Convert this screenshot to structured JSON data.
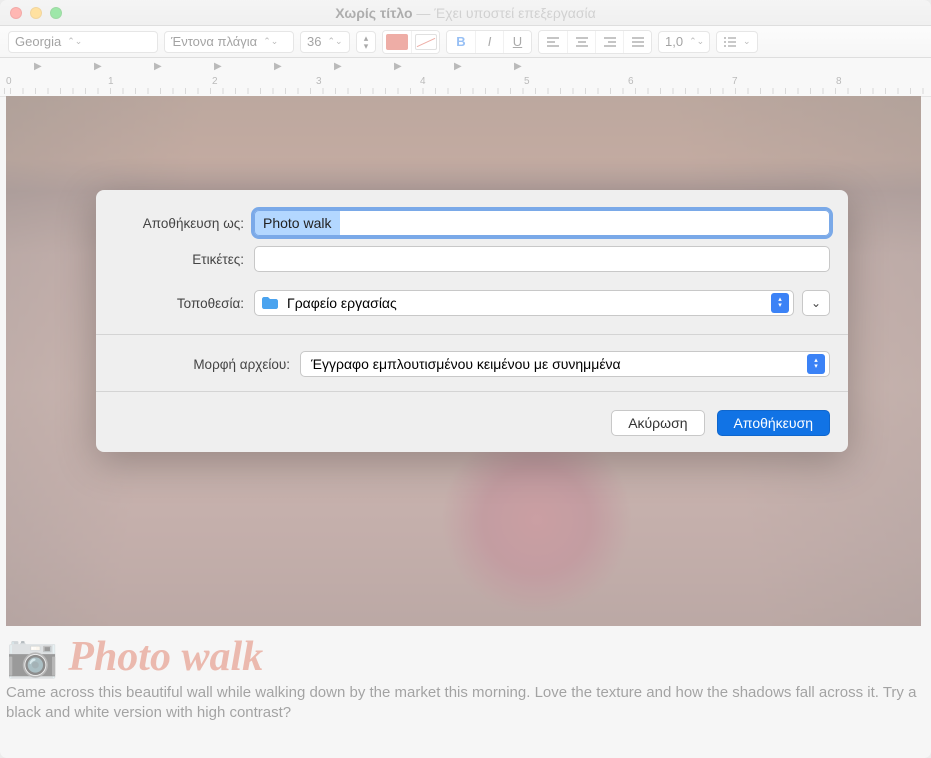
{
  "window": {
    "title": "Χωρίς τίτλο",
    "subtitle": "— Έχει υποστεί επεξεργασία"
  },
  "toolbar": {
    "font": "Georgia",
    "style": "Έντονα πλάγια",
    "size": "36",
    "spacing": "1,0",
    "bold": "B",
    "italic": "I",
    "underline": "U"
  },
  "ruler": {
    "numbers": [
      "0",
      "1",
      "2",
      "3",
      "4",
      "5",
      "6",
      "7",
      "8"
    ]
  },
  "document": {
    "emoji": "📷",
    "headline": "Photo walk",
    "body": "Came across this beautiful wall while walking down by the market this morning. Love the texture and how the shadows fall across it. Try a black and white version with high contrast?"
  },
  "sheet": {
    "save_as_label": "Αποθήκευση ως:",
    "save_as_value": "Photo walk",
    "tags_label": "Ετικέτες:",
    "tags_value": "",
    "where_label": "Τοποθεσία:",
    "where_value": "Γραφείο εργασίας",
    "format_label": "Μορφή αρχείου:",
    "format_value": "Έγγραφο εμπλουτισμένου κειμένου με συνημμένα",
    "cancel": "Ακύρωση",
    "save": "Αποθήκευση"
  }
}
